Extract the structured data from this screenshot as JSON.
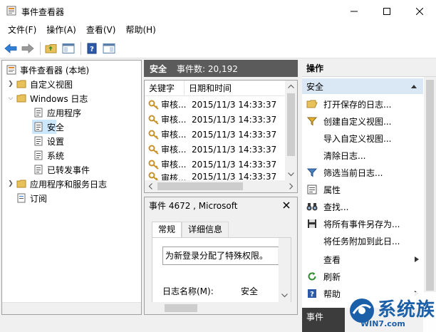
{
  "window": {
    "title": "事件查看器"
  },
  "menu": [
    "文件(F)",
    "操作(A)",
    "查看(V)",
    "帮助(H)"
  ],
  "tree": {
    "items": [
      {
        "label": "事件查看器 (本地)",
        "level": 0,
        "icon": "event-viewer-icon",
        "expanded": true
      },
      {
        "label": "自定义视图",
        "level": 1,
        "icon": "folder-icon",
        "expanded": false
      },
      {
        "label": "Windows 日志",
        "level": 1,
        "icon": "folder-icon",
        "expanded": true
      },
      {
        "label": "应用程序",
        "level": 2,
        "icon": "log-icon"
      },
      {
        "label": "安全",
        "level": 2,
        "icon": "log-icon",
        "selected": true
      },
      {
        "label": "设置",
        "level": 2,
        "icon": "log-icon"
      },
      {
        "label": "系统",
        "level": 2,
        "icon": "log-icon"
      },
      {
        "label": "已转发事件",
        "level": 2,
        "icon": "log-icon"
      },
      {
        "label": "应用程序和服务日志",
        "level": 1,
        "icon": "folder-icon",
        "expanded": false
      },
      {
        "label": "订阅",
        "level": 1,
        "icon": "subscription-icon"
      }
    ]
  },
  "log": {
    "name": "安全",
    "count_text": "事件数: 20,192",
    "columns": [
      "关键字",
      "日期和时间"
    ],
    "rows": [
      {
        "keyword": "审核...",
        "datetime": "2015/11/3 14:33:37"
      },
      {
        "keyword": "审核...",
        "datetime": "2015/11/3 14:33:37"
      },
      {
        "keyword": "审核...",
        "datetime": "2015/11/3 14:33:37"
      },
      {
        "keyword": "审核...",
        "datetime": "2015/11/3 14:33:37"
      },
      {
        "keyword": "审核...",
        "datetime": "2015/11/3 14:33:37"
      },
      {
        "keyword": "审核...",
        "datetime": "2015/11/3 14:33:37"
      }
    ]
  },
  "detail": {
    "title": "事件 4672 , Microsoft",
    "tabs": [
      "常规",
      "详细信息"
    ],
    "description": "为新登录分配了特殊权限。",
    "field_label": "日志名称(M):",
    "field_value": "安全"
  },
  "actions": {
    "title": "操作",
    "group": "安全",
    "items": [
      {
        "label": "打开保存的日志...",
        "icon": "open-folder-icon"
      },
      {
        "label": "创建自定义视图...",
        "icon": "filter-icon"
      },
      {
        "label": "导入自定义视图...",
        "icon": ""
      },
      {
        "label": "清除日志...",
        "icon": ""
      },
      {
        "label": "筛选当前日志...",
        "icon": "filter-icon"
      },
      {
        "label": "属性",
        "icon": "properties-icon"
      },
      {
        "label": "查找...",
        "icon": "binoculars-icon"
      },
      {
        "label": "将所有事件另存为...",
        "icon": "save-icon"
      },
      {
        "label": "将任务附加到此日...",
        "icon": ""
      },
      {
        "label": "查看",
        "icon": "",
        "submenu": true
      },
      {
        "label": "刷新",
        "icon": "refresh-icon"
      },
      {
        "label": "帮助",
        "icon": "help-icon",
        "submenu": true
      }
    ],
    "bottom_group": "事件"
  },
  "watermark": {
    "big": "系统族",
    "small": "WIN7.com"
  }
}
